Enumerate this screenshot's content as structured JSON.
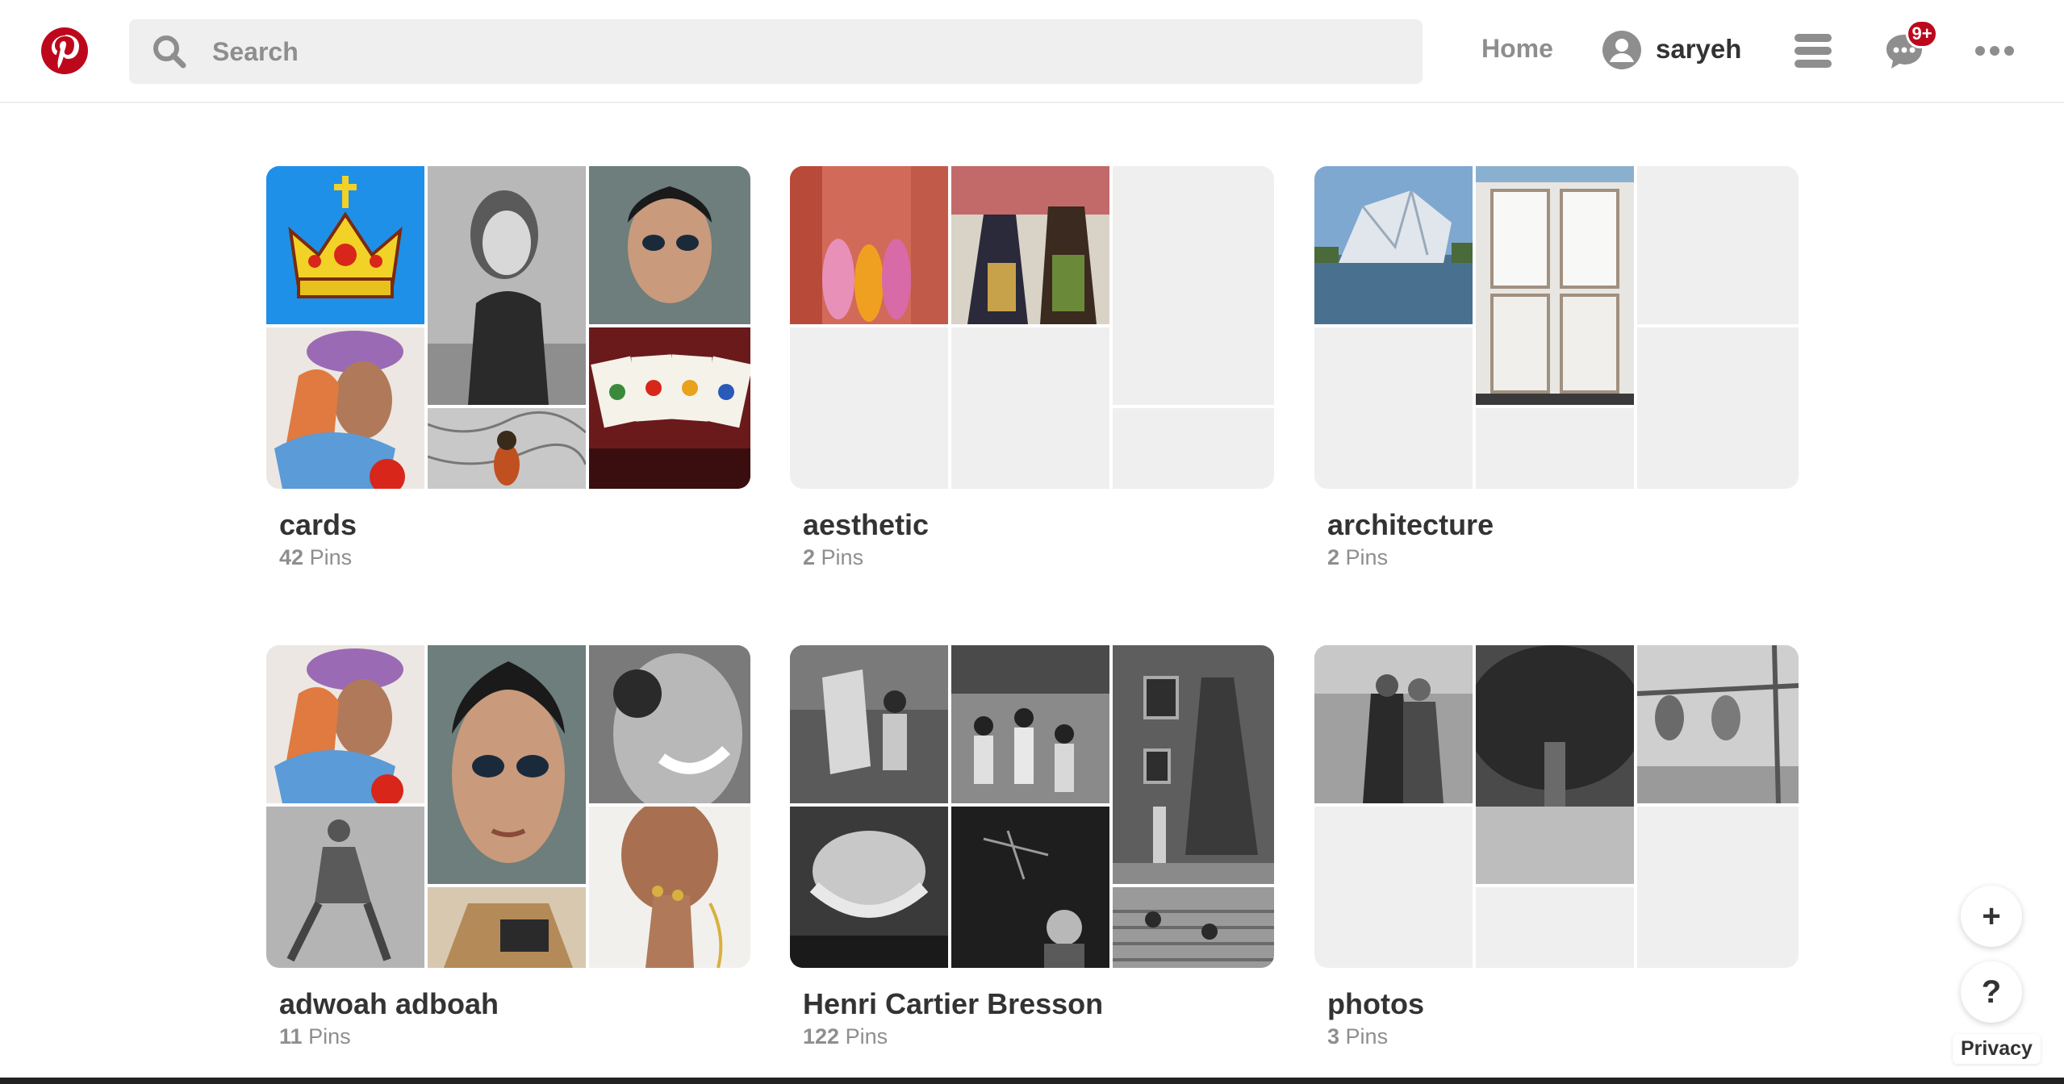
{
  "header": {
    "search_placeholder": "Search",
    "home_label": "Home",
    "username": "saryeh",
    "notification_badge": "9+",
    "brand_color": "#bd081c"
  },
  "boards": [
    {
      "name": "cards",
      "count": "42",
      "count_label": "Pins"
    },
    {
      "name": "aesthetic",
      "count": "2",
      "count_label": "Pins"
    },
    {
      "name": "architecture",
      "count": "2",
      "count_label": "Pins"
    },
    {
      "name": "adwoah adboah",
      "count": "11",
      "count_label": "Pins"
    },
    {
      "name": "Henri Cartier Bresson",
      "count": "122",
      "count_label": "Pins"
    },
    {
      "name": "photos",
      "count": "3",
      "count_label": "Pins"
    }
  ],
  "floating": {
    "plus_label": "+",
    "help_label": "?",
    "privacy_label": "Privacy"
  }
}
